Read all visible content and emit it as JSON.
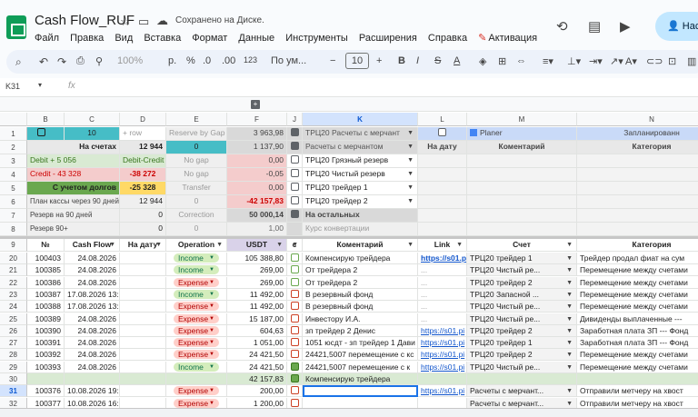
{
  "doc": {
    "title": "Cash Flow_RUF",
    "saved": "Сохранено на Диске.",
    "share": "Нас"
  },
  "menu": [
    "Файл",
    "Правка",
    "Вид",
    "Вставка",
    "Формат",
    "Данные",
    "Инструменты",
    "Расширения",
    "Справка",
    "Активация"
  ],
  "toolbar": {
    "zoom": "100%",
    "currency": "р.",
    "percent": "%",
    "dec_dec": ".0",
    "inc_dec": ".00",
    "format123": "123",
    "font": "По ум...",
    "font_size": "10"
  },
  "namebox": "K31",
  "fx": "fx",
  "columns": [
    "",
    "B",
    "C",
    "D",
    "E",
    "F",
    "J",
    "K",
    "L",
    "M",
    "N"
  ],
  "summary": {
    "r1": {
      "c": "10",
      "d": "+ row",
      "e": "Reserve by Gap",
      "f": "3 963,98",
      "k": "ТРЦ20 Расчеты с мерчант",
      "m": "Planer",
      "n": "Запланированн"
    },
    "r2": {
      "b": "На счетах",
      "d": "12 944",
      "e": "0",
      "f": "1 137,90",
      "k": "Расчеты с мерчантом",
      "l": "На дату",
      "m": "Коментарий",
      "n": "Категория"
    },
    "r3": {
      "b": "Debit + 5 056",
      "d": "Debit-Credit",
      "e": "No gap",
      "f": "0,00",
      "k": "ТРЦ20  Грязный резерв"
    },
    "r4": {
      "b": "Credit - 43 328",
      "d": "-38 272",
      "e": "No gap",
      "f": "-0,05",
      "k": "ТРЦ20  Чистый резерв"
    },
    "r5": {
      "b": "С учетом долгов",
      "d": "-25 328",
      "e": "Transfer",
      "f": "0,00",
      "k": "ТРЦ20  трейдер 1"
    },
    "r6": {
      "b": "План кассы через 90 дней",
      "d": "12 944",
      "e": "0",
      "f": "-42 157,83",
      "k": "ТРЦ20  трейдер 2"
    },
    "r7": {
      "b": "Резерв на 90 дней",
      "d": "0",
      "e": "Correction",
      "f": "50 000,14",
      "k": "На остальных"
    },
    "r8": {
      "b": "Резерв 90+",
      "d": "0",
      "e": "0",
      "f": "1,00",
      "k": "Курс конвертации"
    }
  },
  "headers": {
    "no": "№",
    "cashflow": "Cash Flow",
    "ondate": "На дату",
    "operation": "Operation",
    "usdt": "USDT",
    "c": "c",
    "comment": "Коментарий",
    "link": "Link",
    "account": "Счет",
    "category": "Категория"
  },
  "rows": [
    {
      "rn": "20",
      "no": "100403",
      "date": "24.08.2026",
      "op": "Income",
      "usdt": "105 388,80",
      "chk": false,
      "comment": "Компенсирую трейдера",
      "link": "https://s01.p",
      "account": "ТРЦ20  трейдер 1",
      "category": "Трейдер продал фиат на сум"
    },
    {
      "rn": "21",
      "no": "100385",
      "date": "24.08.2026",
      "op": "Income",
      "usdt": "269,00",
      "chk": false,
      "comment": "От трейдера 2",
      "link": "...",
      "account": "ТРЦ20  Чистый ре...",
      "category": "Перемещение между счетами"
    },
    {
      "rn": "22",
      "no": "100386",
      "date": "24.08.2026",
      "op": "Expense",
      "usdt": "269,00",
      "chk": false,
      "comment": "От трейдера 2",
      "link": "...",
      "account": "ТРЦ20  трейдер 2",
      "category": "Перемещение между счетами"
    },
    {
      "rn": "23",
      "no": "100387",
      "date": "17.08.2026 13:",
      "op": "Income",
      "usdt": "11 492,00",
      "chk": false,
      "comment": "В резервный фонд",
      "link": "...",
      "account": "ТРЦ20  Запасной ...",
      "category": "Перемещение между счетами"
    },
    {
      "rn": "24",
      "no": "100388",
      "date": "17.08.2026 13:",
      "op": "Expense",
      "usdt": "11 492,00",
      "chk": false,
      "comment": "В резервный фонд",
      "link": "...",
      "account": "ТРЦ20  Чистый ре...",
      "category": "Перемещение между счетами"
    },
    {
      "rn": "25",
      "no": "100389",
      "date": "24.08.2026",
      "op": "Expense",
      "usdt": "15 187,00",
      "chk": false,
      "comment": "Инвестору И.А.",
      "link": "...",
      "account": "ТРЦ20  Чистый ре...",
      "category": "Дивиденды выплаченные ---"
    },
    {
      "rn": "26",
      "no": "100390",
      "date": "24.08.2026",
      "op": "Expense",
      "usdt": "604,63",
      "chk": false,
      "comment": "зп трейдер 2 Денис",
      "link": "https://s01.pi",
      "account": "ТРЦ20  трейдер 2",
      "category": "Заработная плата ЗП --- Фонд"
    },
    {
      "rn": "27",
      "no": "100391",
      "date": "24.08.2026",
      "op": "Expense",
      "usdt": "1 051,00",
      "chk": false,
      "comment": "1051 юсдт - зп трейдер 1 Дави",
      "link": "https://s01.pi",
      "account": "ТРЦ20  трейдер 1",
      "category": "Заработная плата ЗП --- Фонд"
    },
    {
      "rn": "28",
      "no": "100392",
      "date": "24.08.2026",
      "op": "Expense",
      "usdt": "24 421,50",
      "chk": false,
      "comment": "24421,5007 перемещение с кс",
      "link": "https://s01.pi",
      "account": "ТРЦ20  трейдер 2",
      "category": "Перемещение между счетами"
    },
    {
      "rn": "29",
      "no": "100393",
      "date": "24.08.2026",
      "op": "Income",
      "usdt": "24 421,50",
      "chk": true,
      "comment": "24421,5007 перемещение с к",
      "link": "https://s01.pi",
      "account": "ТРЦ20  Чистый ре...",
      "category": "Перемещение между счетами"
    },
    {
      "rn": "30",
      "no": "",
      "date": "",
      "op": "",
      "usdt": "42 157,83",
      "chk": true,
      "comment": "Компенсирую трейдера",
      "link": "",
      "account": "",
      "category": ""
    },
    {
      "rn": "31",
      "no": "100376",
      "date": "10.08.2026 19:",
      "op": "Expense",
      "usdt": "200,00",
      "chk": false,
      "comment": "",
      "link": "https://s01.pi",
      "account": "Расчеты с мерчант...",
      "category": "Отправили метчеру на хвост"
    },
    {
      "rn": "32",
      "no": "100377",
      "date": "10.08.2026 16:",
      "op": "Expense",
      "usdt": "1 200,00",
      "chk": false,
      "comment": "",
      "link": "",
      "account": "Расчеты с мерчант...",
      "category": "Отправили метчеру на хвост"
    }
  ],
  "colors": {
    "income_bg": "#d4edbc",
    "income_fg": "#11734b",
    "expense_bg": "#ffcfc9",
    "expense_fg": "#b10202",
    "teal": "#46bdc6",
    "accent_blue": "#c2e7ff"
  }
}
